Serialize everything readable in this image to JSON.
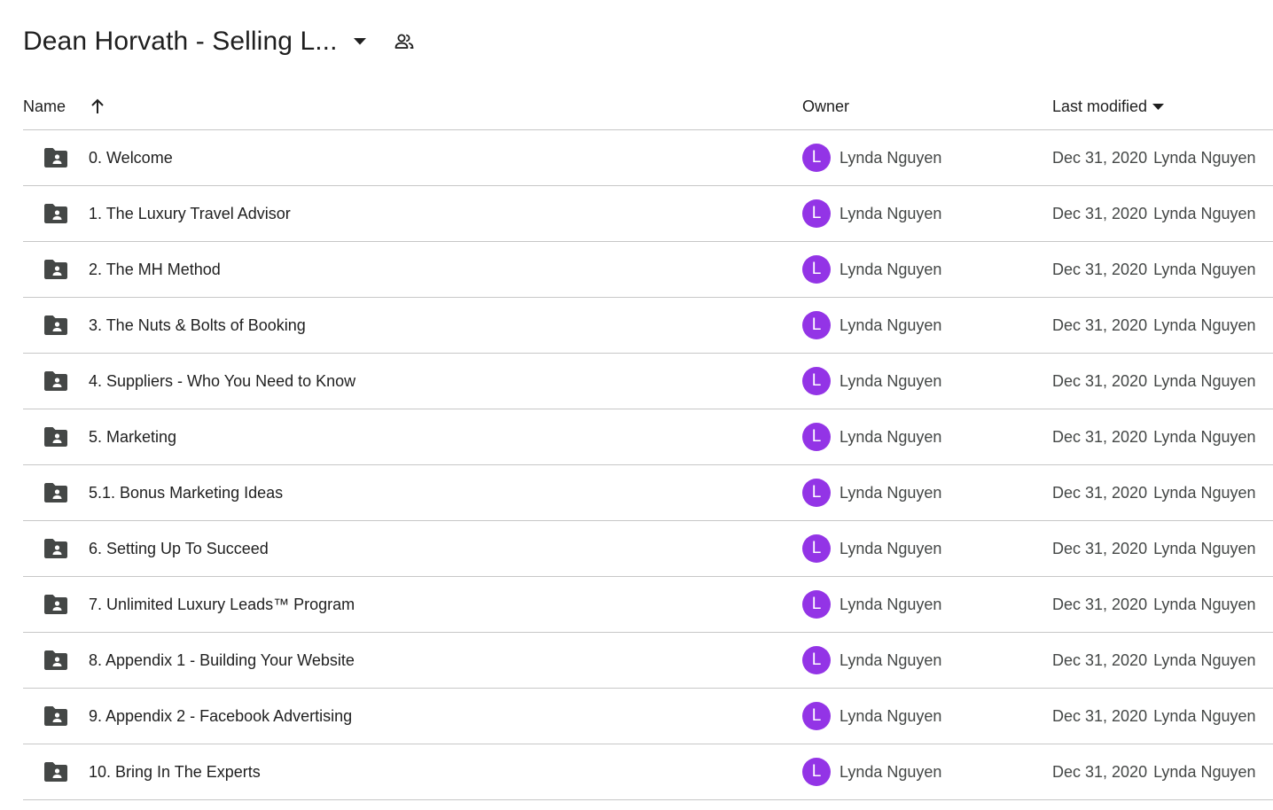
{
  "header": {
    "title": "Dean Horvath - Selling L...",
    "dropdown_icon": "arrow-drop-down-icon",
    "shared_icon": "people-icon"
  },
  "columns": {
    "name": "Name",
    "owner": "Owner",
    "last_modified": "Last modified",
    "sort_icon": "arrow-upward-icon",
    "modified_sort_icon": "arrow-drop-down-icon"
  },
  "colors": {
    "avatar_bg": "#9334e6",
    "folder_icon": "#444746",
    "divider": "#c7c7c7"
  },
  "rows": [
    {
      "name": "0. Welcome",
      "owner_initial": "L",
      "owner": "Lynda Nguyen",
      "modified_date": "Dec 31, 2020",
      "modified_by": "Lynda Nguyen"
    },
    {
      "name": "1. The Luxury Travel Advisor",
      "owner_initial": "L",
      "owner": "Lynda Nguyen",
      "modified_date": "Dec 31, 2020",
      "modified_by": "Lynda Nguyen"
    },
    {
      "name": "2. The MH Method",
      "owner_initial": "L",
      "owner": "Lynda Nguyen",
      "modified_date": "Dec 31, 2020",
      "modified_by": "Lynda Nguyen"
    },
    {
      "name": "3. The Nuts & Bolts of Booking",
      "owner_initial": "L",
      "owner": "Lynda Nguyen",
      "modified_date": "Dec 31, 2020",
      "modified_by": "Lynda Nguyen"
    },
    {
      "name": "4. Suppliers - Who You Need to Know",
      "owner_initial": "L",
      "owner": "Lynda Nguyen",
      "modified_date": "Dec 31, 2020",
      "modified_by": "Lynda Nguyen"
    },
    {
      "name": "5. Marketing",
      "owner_initial": "L",
      "owner": "Lynda Nguyen",
      "modified_date": "Dec 31, 2020",
      "modified_by": "Lynda Nguyen"
    },
    {
      "name": "5.1. Bonus Marketing Ideas",
      "owner_initial": "L",
      "owner": "Lynda Nguyen",
      "modified_date": "Dec 31, 2020",
      "modified_by": "Lynda Nguyen"
    },
    {
      "name": "6. Setting Up To Succeed",
      "owner_initial": "L",
      "owner": "Lynda Nguyen",
      "modified_date": "Dec 31, 2020",
      "modified_by": "Lynda Nguyen"
    },
    {
      "name": "7. Unlimited Luxury Leads™ Program",
      "owner_initial": "L",
      "owner": "Lynda Nguyen",
      "modified_date": "Dec 31, 2020",
      "modified_by": "Lynda Nguyen"
    },
    {
      "name": "8. Appendix 1 - Building Your Website",
      "owner_initial": "L",
      "owner": "Lynda Nguyen",
      "modified_date": "Dec 31, 2020",
      "modified_by": "Lynda Nguyen"
    },
    {
      "name": "9. Appendix 2 - Facebook Advertising",
      "owner_initial": "L",
      "owner": "Lynda Nguyen",
      "modified_date": "Dec 31, 2020",
      "modified_by": "Lynda Nguyen"
    },
    {
      "name": "10. Bring In The Experts",
      "owner_initial": "L",
      "owner": "Lynda Nguyen",
      "modified_date": "Dec 31, 2020",
      "modified_by": "Lynda Nguyen"
    }
  ]
}
